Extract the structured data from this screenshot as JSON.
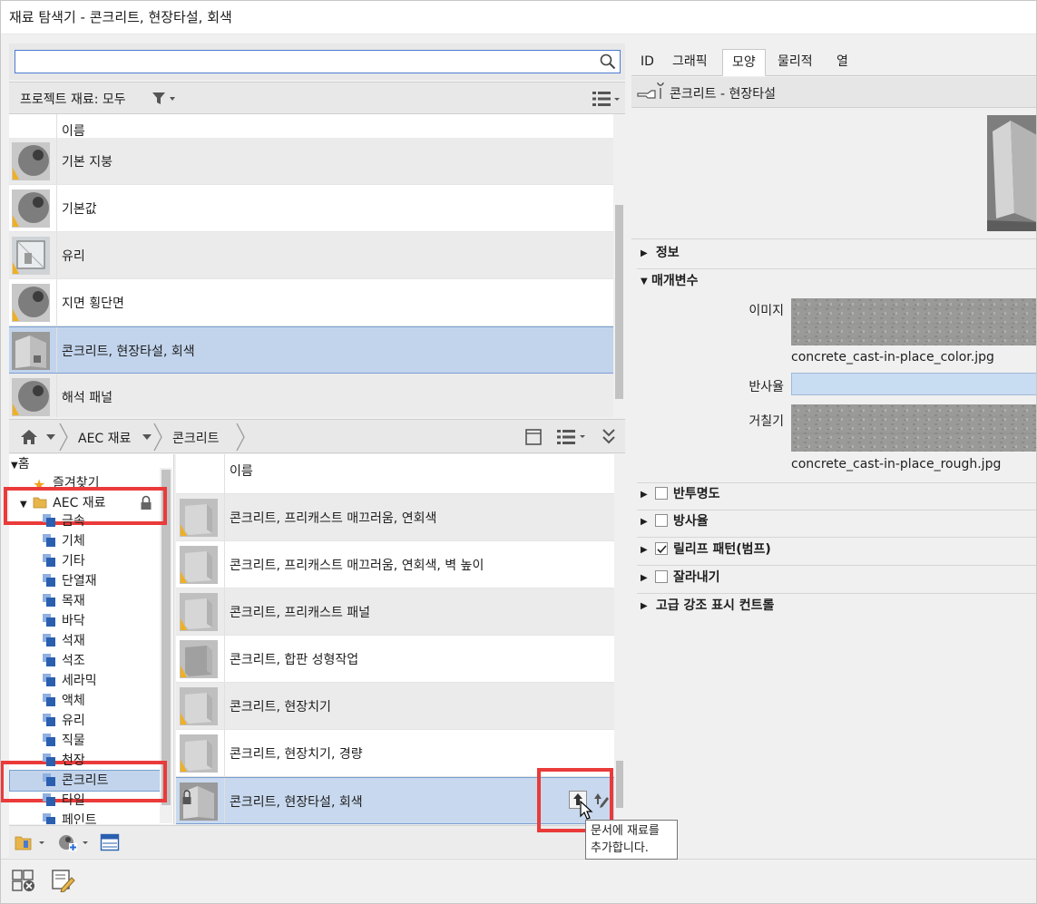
{
  "window": {
    "title": "재료 탐색기 - 콘크리트, 현장타설, 회색"
  },
  "search": {
    "value": "",
    "placeholder": ""
  },
  "project_filter": {
    "label": "프로젝트 재료: 모두"
  },
  "project_list": {
    "column_name": "이름",
    "items": [
      {
        "name": "기본 지붕",
        "thumb": "sphere"
      },
      {
        "name": "기본값",
        "thumb": "sphere"
      },
      {
        "name": "유리",
        "thumb": "glass"
      },
      {
        "name": "지면 횡단면",
        "thumb": "sphere"
      },
      {
        "name": "콘크리트, 현장타설, 회색",
        "thumb": "concrete-wall",
        "selected": true
      },
      {
        "name": "해석 패널",
        "thumb": "sphere"
      }
    ]
  },
  "breadcrumb": {
    "items": [
      "AEC 재료",
      "콘크리트"
    ]
  },
  "tree": {
    "root": "홈",
    "favorites": "즐겨찾기",
    "library": "AEC 재료",
    "categories": [
      "금속",
      "기체",
      "기타",
      "단열재",
      "목재",
      "바닥",
      "석재",
      "석조",
      "세라믹",
      "액체",
      "유리",
      "직물",
      "천장",
      "콘크리트",
      "타일",
      "페인트"
    ],
    "selected": "콘크리트"
  },
  "library_list": {
    "column_name": "이름",
    "items": [
      {
        "name": "콘크리트, 프리캐스트 매끄러움, 연회색",
        "thumb": "cube"
      },
      {
        "name": "콘크리트, 프리캐스트 매끄러움, 연회색, 벽 높이",
        "thumb": "cube"
      },
      {
        "name": "콘크리트, 프리캐스트 패널",
        "thumb": "cube"
      },
      {
        "name": "콘크리트, 합판 성형작업",
        "thumb": "cube-rough"
      },
      {
        "name": "콘크리트, 현장치기",
        "thumb": "cube"
      },
      {
        "name": "콘크리트, 현장치기, 경량",
        "thumb": "cube"
      },
      {
        "name": "콘크리트, 현장타설, 회색",
        "thumb": "concrete-wall",
        "selected": true
      }
    ]
  },
  "tooltip": {
    "line1": "문서에 재료를",
    "line2": "추가합니다."
  },
  "tabs": [
    {
      "label": "ID"
    },
    {
      "label": "그래픽"
    },
    {
      "label": "모양",
      "active": true
    },
    {
      "label": "물리적"
    },
    {
      "label": "열"
    }
  ],
  "asset": {
    "name": "콘크리트 - 현장타설"
  },
  "sections": {
    "info": "정보",
    "params": "매개변수",
    "image_label": "이미지",
    "image_file": "concrete_cast-in-place_color.jpg",
    "reflectance_label": "반사율",
    "roughness_label": "거칠기",
    "roughness_file": "concrete_cast-in-place_rough.jpg",
    "transparency": "반투명도",
    "selfillum": "방사율",
    "relief": "릴리프 패턴(범프)",
    "cutout": "잘라내기",
    "highlight": "고급 강조 표시 컨트롤"
  },
  "colors": {
    "accent_selection": "#c2d4ec",
    "annotation_red": "#ea3a3a"
  }
}
